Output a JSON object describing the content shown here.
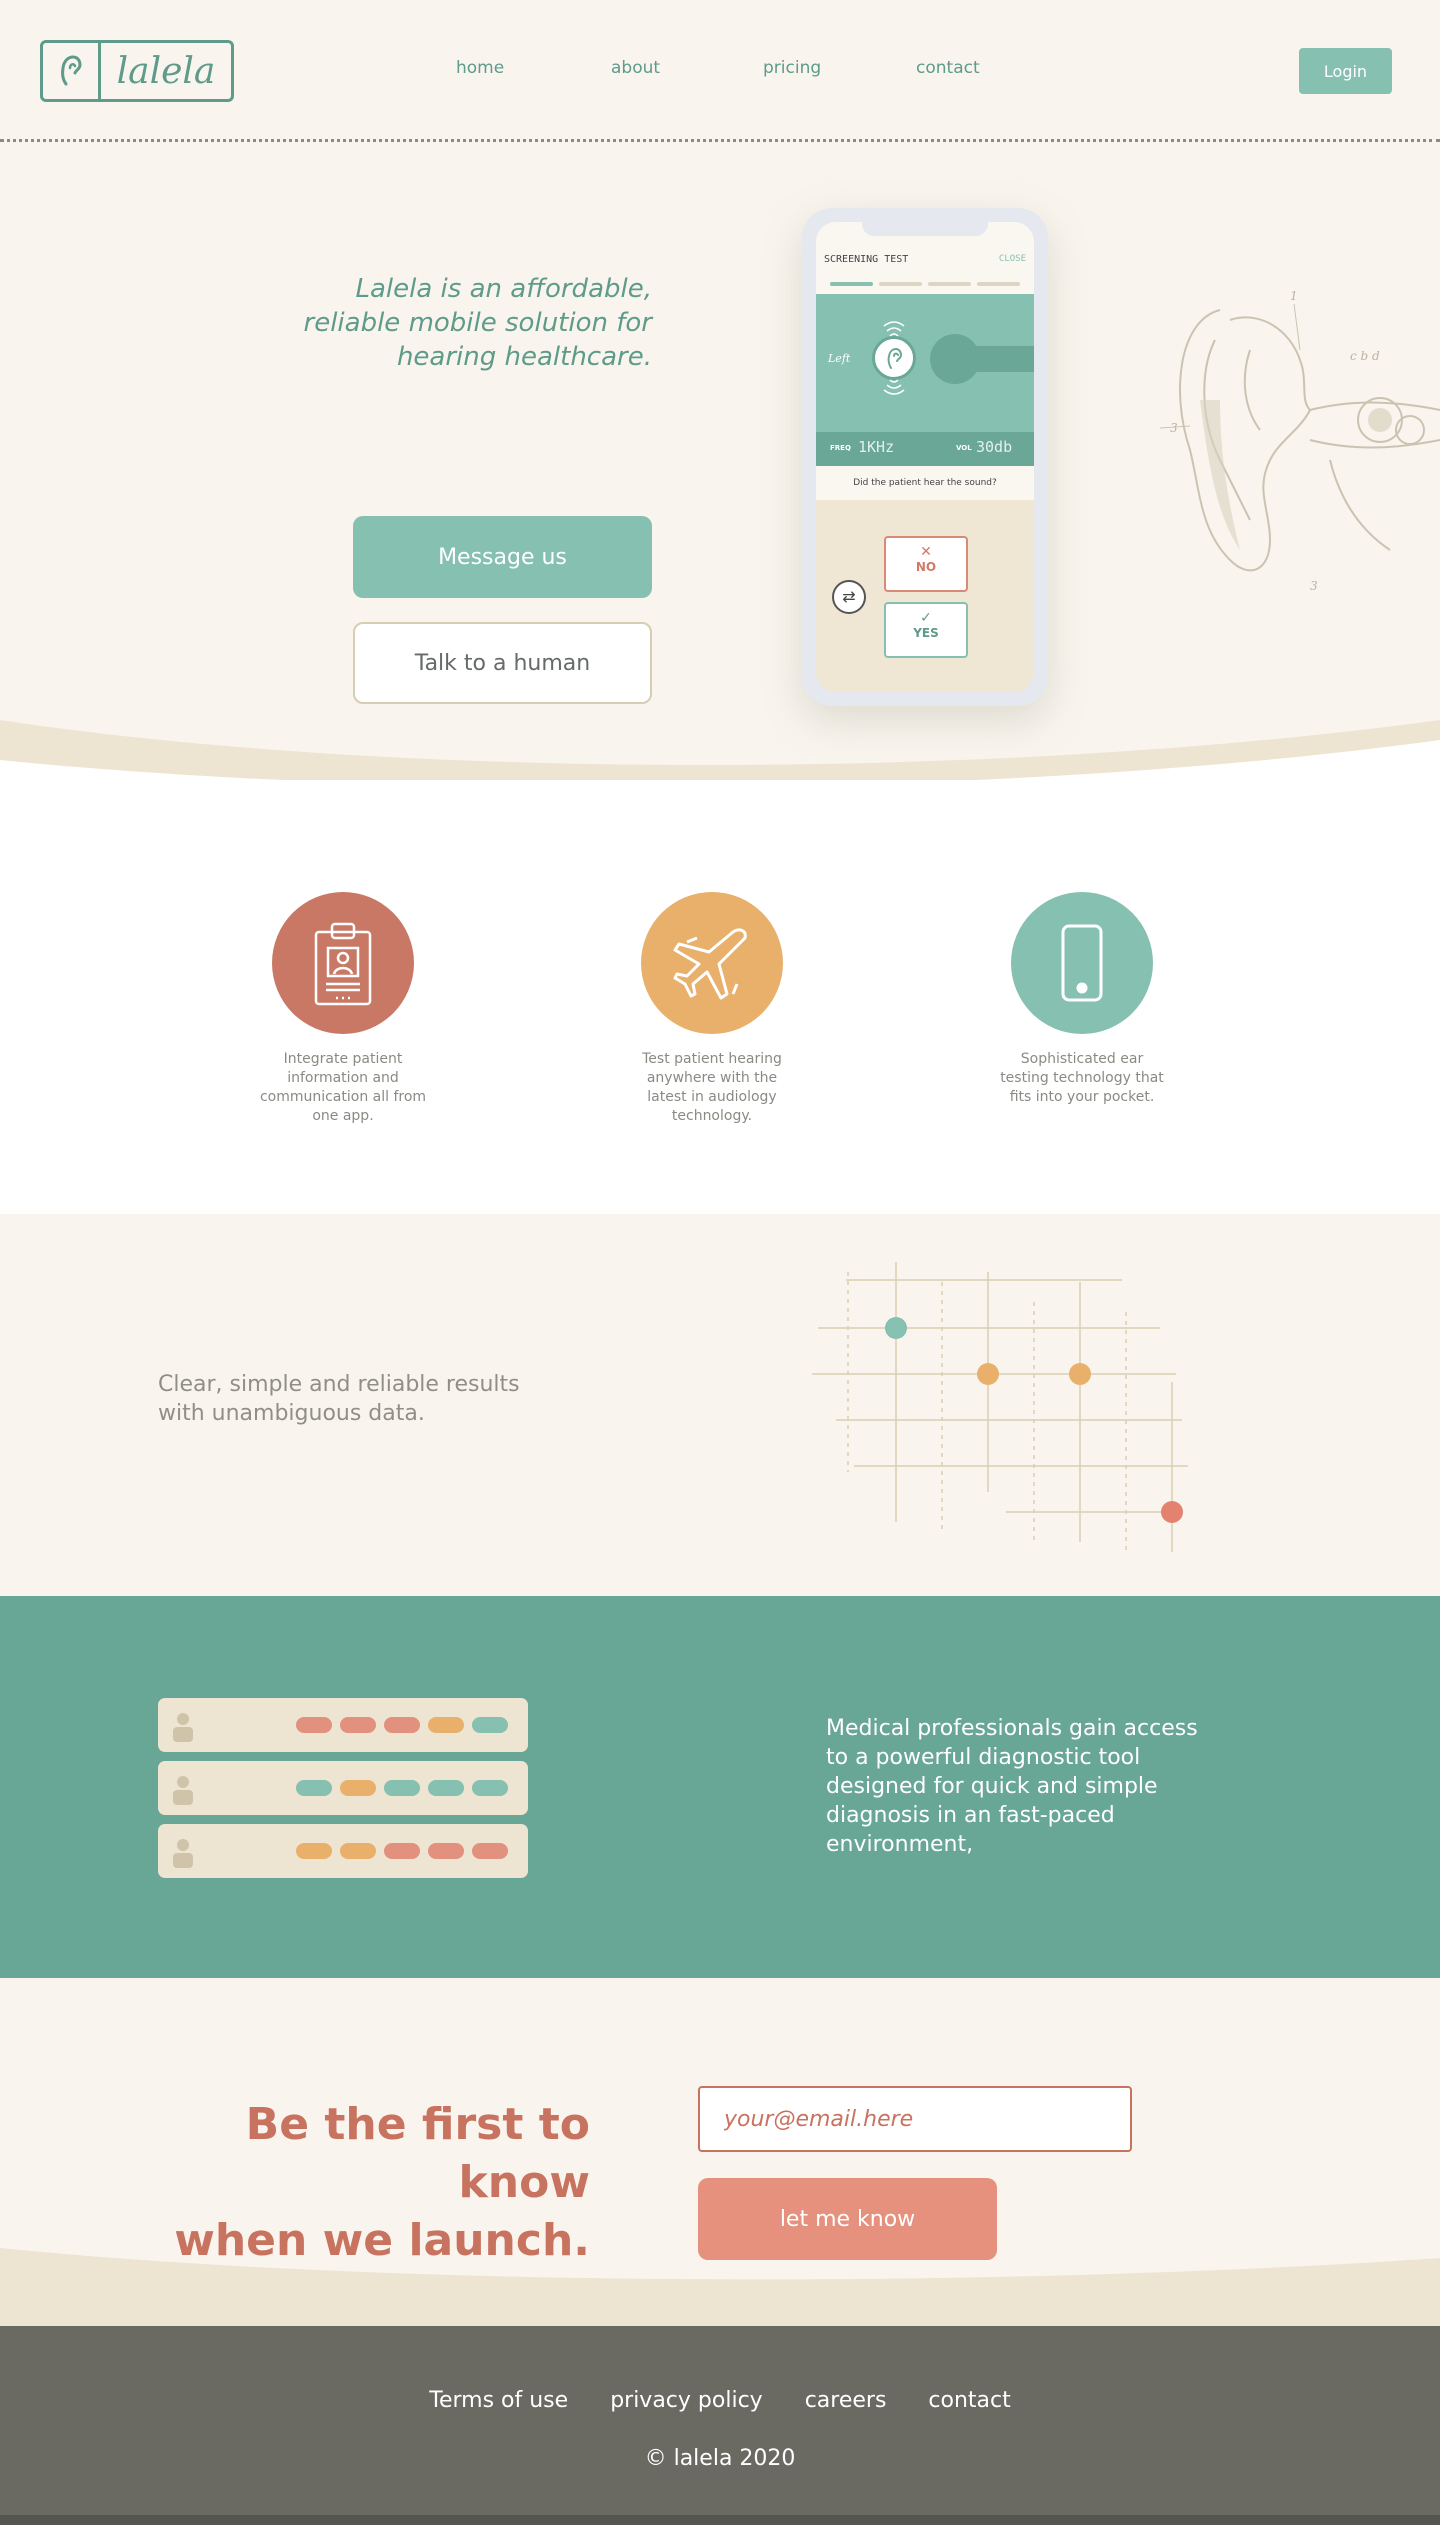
{
  "header": {
    "logo_text": "lalela",
    "nav": [
      "home",
      "about",
      "pricing",
      "contact"
    ],
    "login_label": "Login"
  },
  "hero": {
    "tagline": "Lalela is an affordable, reliable mobile solution for hearing healthcare.",
    "primary_button": "Message us",
    "secondary_button": "Talk to a human",
    "phone": {
      "title": "SCREENING TEST",
      "close": "CLOSE",
      "progress": {
        "current_step": 1,
        "total_steps": 4
      },
      "ear_side": "Left",
      "freq_label": "FREQ",
      "freq_value": "1KHz",
      "vol_label": "VOL",
      "vol_value": "30db",
      "question": "Did the patient hear the sound?",
      "no_label": "NO",
      "yes_label": "YES"
    }
  },
  "features": [
    {
      "icon": "clipboard-id-icon",
      "text": "Integrate patient information and communication all from one app."
    },
    {
      "icon": "airplane-icon",
      "text": "Test patient hearing anywhere with the latest in audiology technology."
    },
    {
      "icon": "smartphone-icon",
      "text": "Sophisticated ear testing technology that fits into your pocket."
    }
  ],
  "results": {
    "text": "Clear, simple and reliable results with unambiguous data."
  },
  "professionals": {
    "text": "Medical professionals gain access to a powerful diagnostic tool designed for quick and simple diagnosis in an fast-paced environment,",
    "rows": [
      [
        "red",
        "red",
        "red",
        "orange",
        "green"
      ],
      [
        "green",
        "orange",
        "green",
        "green",
        "green"
      ],
      [
        "orange",
        "orange",
        "red",
        "red",
        "red"
      ]
    ]
  },
  "signup": {
    "heading_line1": "Be the first to know",
    "heading_line2": "when we launch.",
    "email_placeholder": "your@email.here",
    "button_label": "let me know"
  },
  "footer": {
    "links": [
      "Terms of use",
      "privacy policy",
      "careers",
      "contact"
    ],
    "copyright": "© lalela 2020"
  },
  "colors": {
    "brand_green": "#5e9b8a",
    "mint": "#86c0b0",
    "teal_band": "#68a695",
    "coral": "#c8735f",
    "salmon": "#e5917e",
    "orange": "#e9b06c",
    "cream": "#f9f5ee",
    "footer_gray": "#6a6a62"
  }
}
